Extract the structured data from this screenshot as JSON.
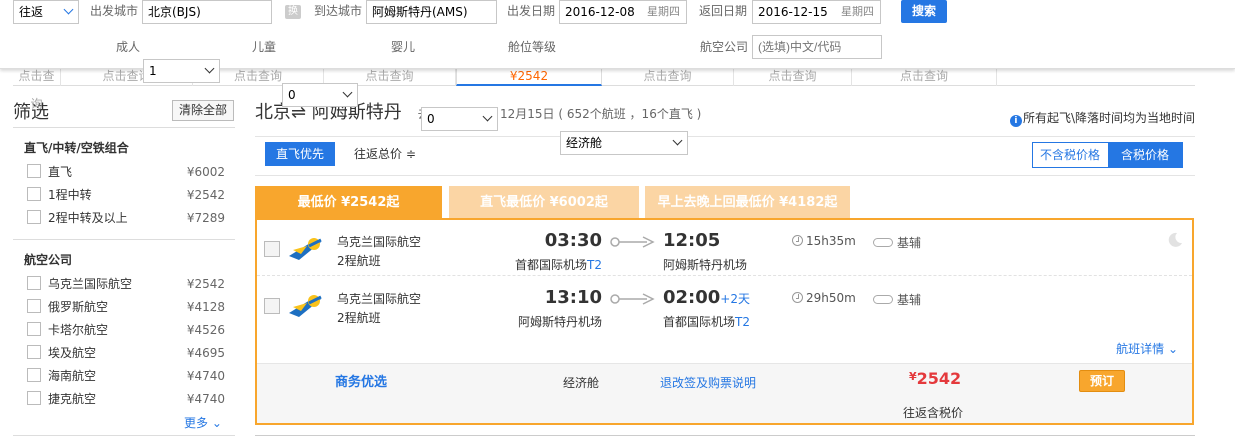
{
  "search": {
    "trip_type": "往返",
    "from_label": "出发城市",
    "from_value": "北京(BJS)",
    "swap_label": "换",
    "to_label": "到达城市",
    "to_value": "阿姆斯特丹(AMS)",
    "depart_label": "出发日期",
    "depart_date": "2016-12-08",
    "depart_weekday": "星期四",
    "return_label": "返回日期",
    "return_date": "2016-12-15",
    "return_weekday": "星期四",
    "search_button": "搜索",
    "adult_label": "成人",
    "adult_value": "1",
    "child_label": "儿童",
    "child_value": "0",
    "infant_label": "婴儿",
    "infant_value": "0",
    "cabin_label": "舱位等级",
    "cabin_value": "经济舱",
    "airline_label": "航空公司",
    "airline_placeholder": "(选填)中文/代码"
  },
  "date_strip": {
    "cells": [
      "点击查询",
      "点击查询",
      "点击查询",
      "¥2542",
      "点击查询",
      "点击查询",
      "点击查询",
      "点击查询"
    ]
  },
  "filters": {
    "title": "筛选",
    "clear_all": "清除全部",
    "stops_title": "直飞/中转/空铁组合",
    "stops": [
      {
        "label": "直飞",
        "price": "¥6002"
      },
      {
        "label": "1程中转",
        "price": "¥2542"
      },
      {
        "label": "2程中转及以上",
        "price": "¥7289"
      }
    ],
    "airlines_title": "航空公司",
    "airlines": [
      {
        "label": "乌克兰国际航空",
        "price": "¥2542"
      },
      {
        "label": "俄罗斯航空",
        "price": "¥4128"
      },
      {
        "label": "卡塔尔航空",
        "price": "¥4526"
      },
      {
        "label": "埃及航空",
        "price": "¥4695"
      },
      {
        "label": "海南航空",
        "price": "¥4740"
      },
      {
        "label": "捷克航空",
        "price": "¥4740"
      }
    ],
    "more": "更多"
  },
  "route": {
    "title": "北京⇌ 阿姆斯特丹",
    "info": "去 12月8日   返 12月15日 ( 652个航班 ，16个直飞 )",
    "tz_note": "所有起飞\\降落时间均为当地时间"
  },
  "sortbar": {
    "direct_first": "直飞优先",
    "round_total": "往返总价 ≑",
    "no_tax": "不含税价格",
    "with_tax": "含税价格"
  },
  "price_tabs": {
    "lowest": "最低价 ¥2542起",
    "direct_lowest": "直飞最低价 ¥6002起",
    "return_lowest": "早上去晚上回最低价 ¥4182起"
  },
  "flight": {
    "legs": [
      {
        "airline": "乌克兰国际航空",
        "flight_no": "2程航班",
        "dep_time": "03:30",
        "dep_airport": "首都国际机场",
        "dep_terminal": "T2",
        "arr_time": "12:05",
        "arr_plus": "",
        "arr_airport": "阿姆斯特丹机场",
        "arr_terminal": "",
        "duration": "15h35m",
        "meal": "基辅"
      },
      {
        "airline": "乌克兰国际航空",
        "flight_no": "2程航班",
        "dep_time": "13:10",
        "dep_airport": "阿姆斯特丹机场",
        "dep_terminal": "",
        "arr_time": "02:00",
        "arr_plus": "+2天",
        "arr_airport": "首都国际机场",
        "arr_terminal": "T2",
        "duration": "29h50m",
        "meal": "基辅"
      }
    ],
    "detail_link": "航班详情",
    "biz_brand": "商务优选",
    "cabin": "经济舱",
    "rules": "退改签及购票说明",
    "currency": "¥",
    "price": "2542",
    "book": "预订",
    "tax_note": "往返含税价"
  },
  "colors": {
    "accent": "#2577e3",
    "orange": "#f8a62d",
    "price_red": "#e4393c"
  }
}
